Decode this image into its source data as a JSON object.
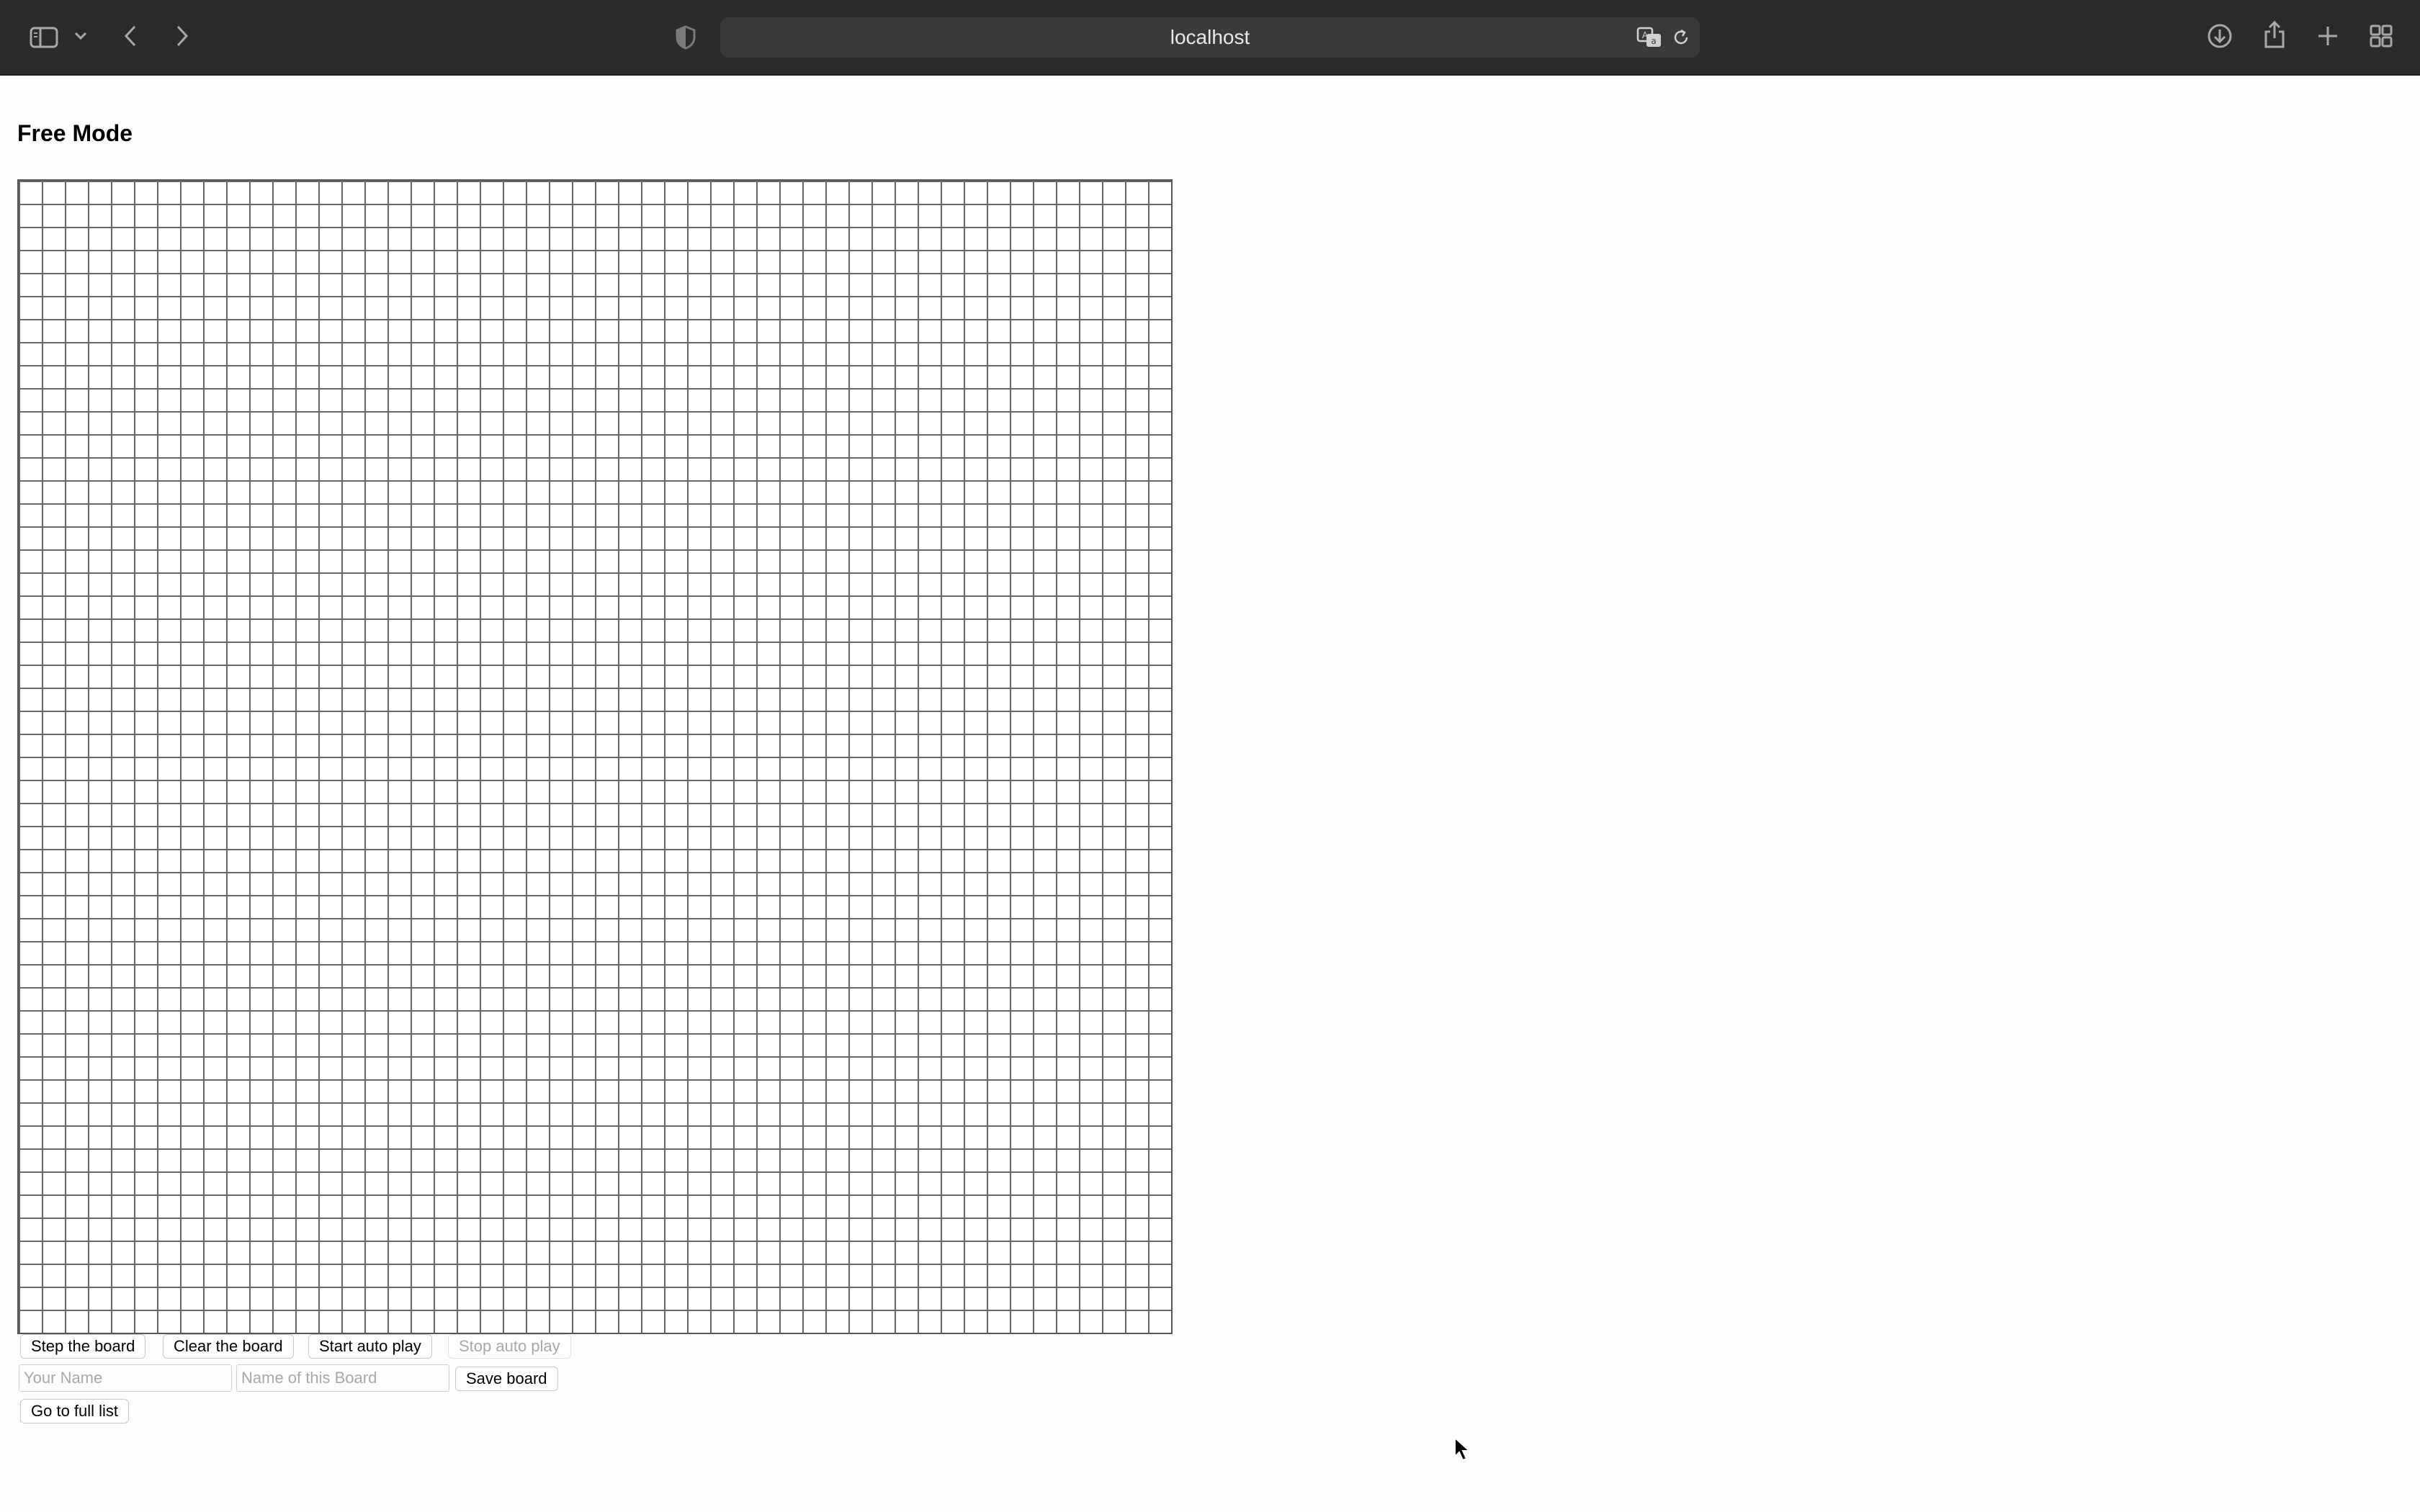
{
  "browser": {
    "url": "localhost",
    "icons": [
      "sidebar-icon",
      "chevron-down-icon",
      "back-icon",
      "forward-icon",
      "privacy-shield-icon",
      "translate-icon",
      "reload-icon",
      "download-icon",
      "share-icon",
      "new-tab-icon",
      "tab-overview-icon"
    ]
  },
  "page": {
    "title": "Free Mode"
  },
  "board": {
    "columns": 50,
    "rows": 50,
    "grid_color": "#666666",
    "cell_color": "#ffffff"
  },
  "controls": {
    "step_label": "Step the board",
    "clear_label": "Clear the board",
    "start_auto_label": "Start auto play",
    "stop_auto_label": "Stop auto play",
    "name_placeholder": "Your Name",
    "name_value": "",
    "board_name_placeholder": "Name of this Board",
    "board_name_value": "",
    "save_label": "Save board",
    "full_list_label": "Go to full list"
  }
}
